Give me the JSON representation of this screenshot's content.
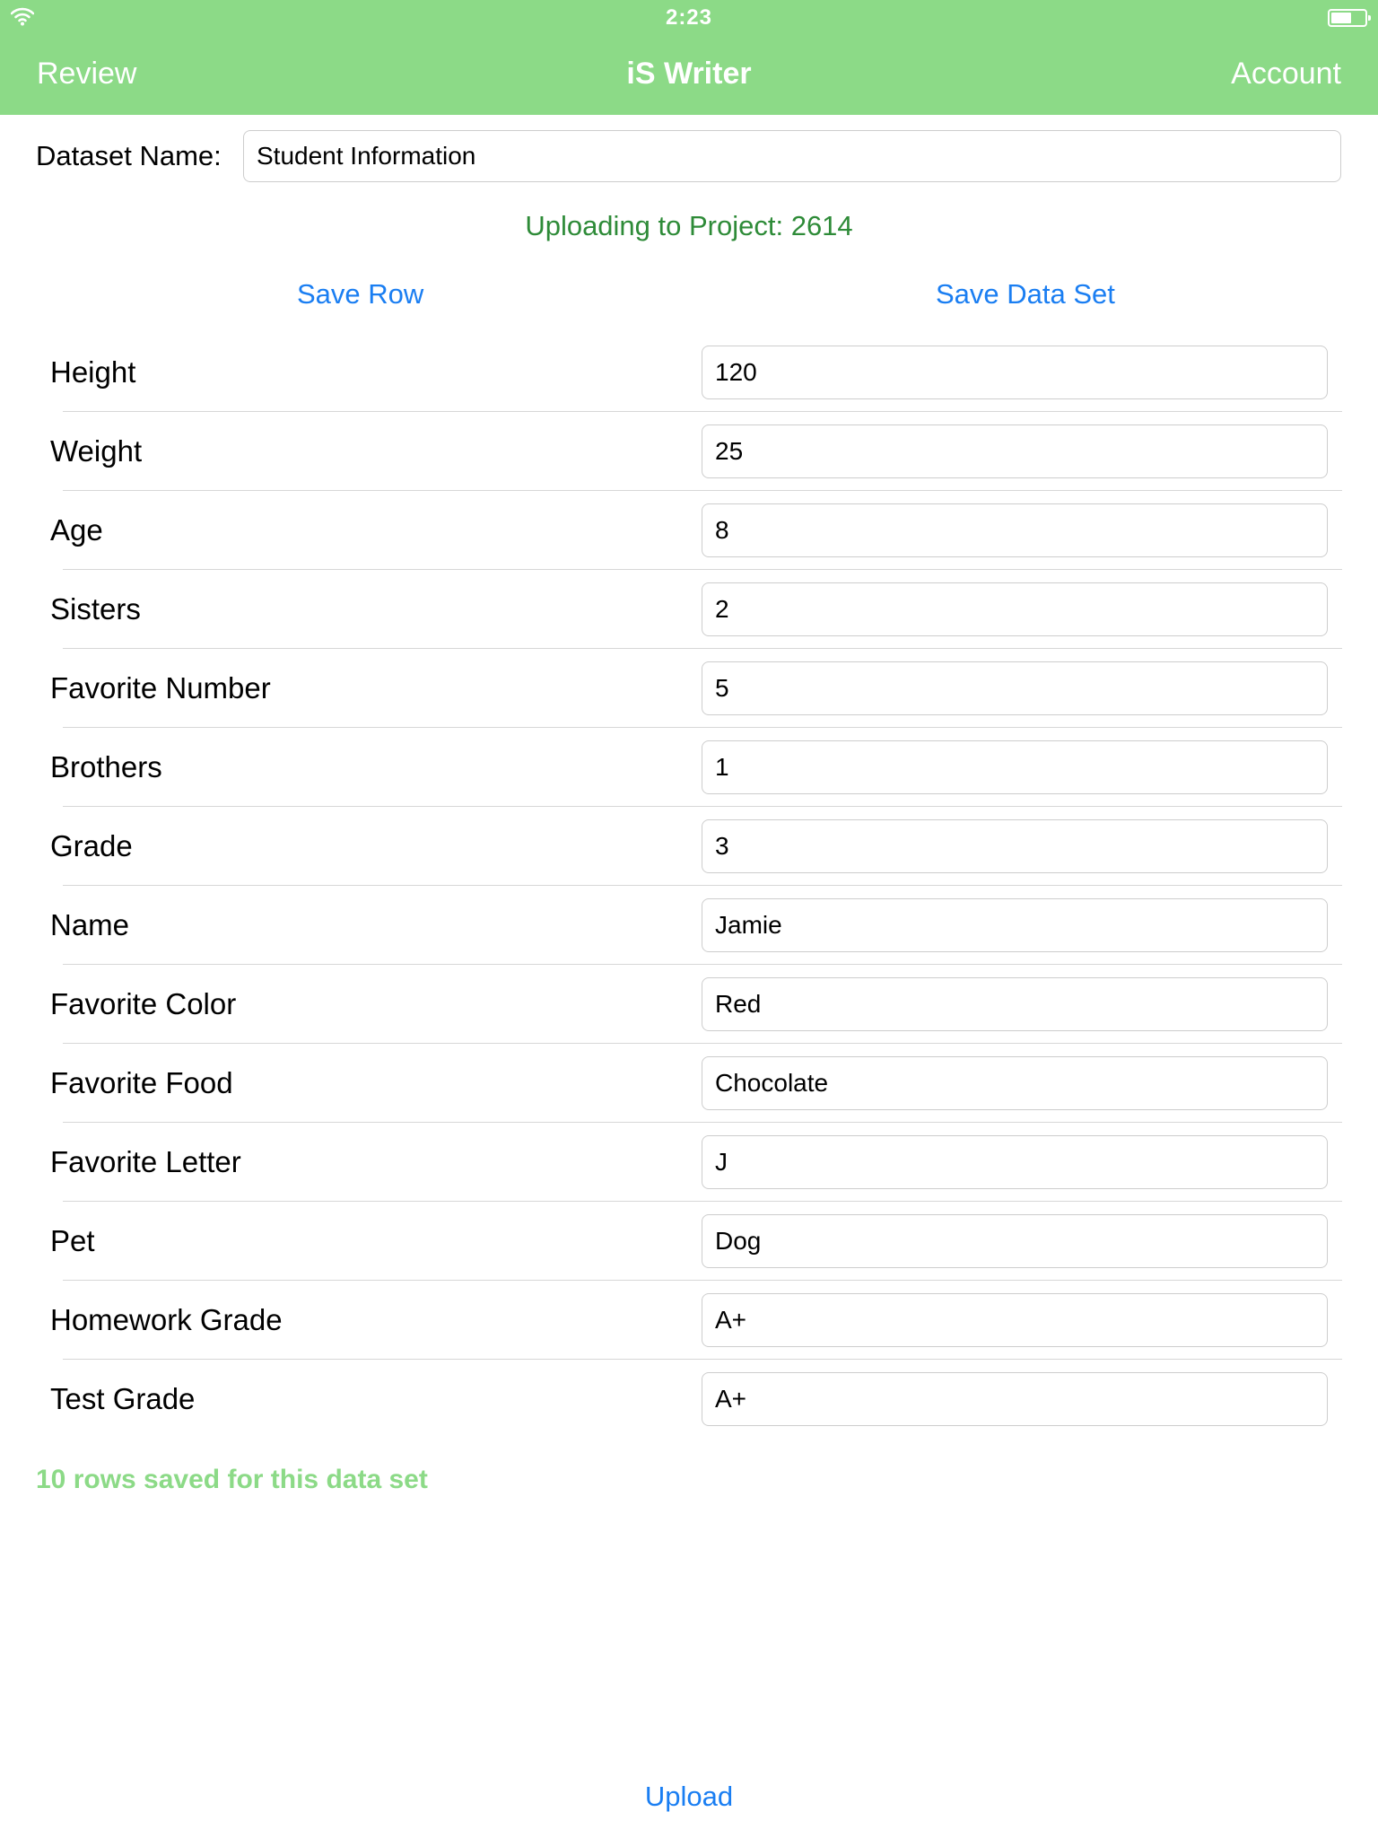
{
  "status_bar": {
    "time": "2:23"
  },
  "nav": {
    "left": "Review",
    "title": "iS Writer",
    "right": "Account"
  },
  "dataset": {
    "label": "Dataset Name:",
    "value": "Student Information"
  },
  "uploading": "Uploading to Project: 2614",
  "actions": {
    "save_row": "Save Row",
    "save_data_set": "Save Data Set"
  },
  "fields": [
    {
      "label": "Height",
      "value": "120"
    },
    {
      "label": "Weight",
      "value": "25"
    },
    {
      "label": "Age",
      "value": "8"
    },
    {
      "label": "Sisters",
      "value": "2"
    },
    {
      "label": "Favorite Number",
      "value": "5"
    },
    {
      "label": "Brothers",
      "value": "1"
    },
    {
      "label": "Grade",
      "value": "3"
    },
    {
      "label": "Name",
      "value": "Jamie"
    },
    {
      "label": "Favorite Color",
      "value": "Red"
    },
    {
      "label": "Favorite Food",
      "value": "Chocolate"
    },
    {
      "label": "Favorite Letter",
      "value": "J"
    },
    {
      "label": "Pet",
      "value": "Dog"
    },
    {
      "label": "Homework Grade",
      "value": "A+"
    },
    {
      "label": "Test Grade",
      "value": "A+"
    }
  ],
  "rows_saved": "10 rows saved for this data set",
  "upload": "Upload",
  "colors": {
    "header": "#8cda87",
    "link": "#1a7ef2",
    "uploading": "#2e8b38",
    "rows_saved": "#8cda87"
  },
  "icons": {
    "wifi": "wifi-icon",
    "battery": "battery-icon"
  }
}
